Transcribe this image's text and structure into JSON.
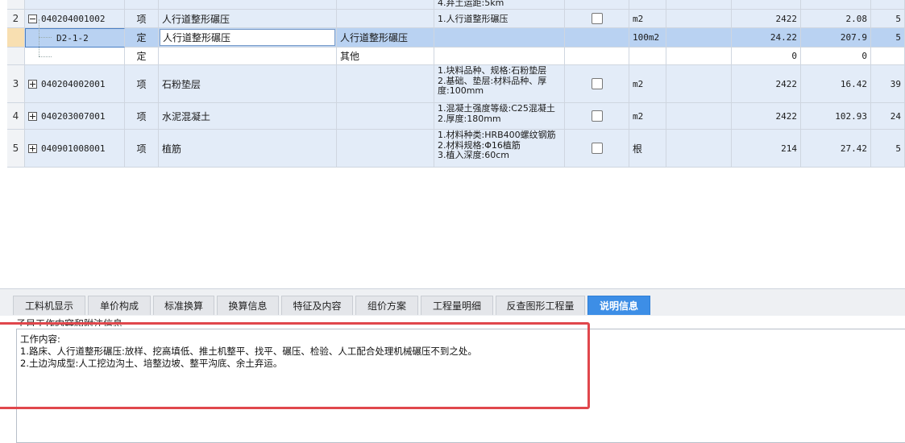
{
  "top_partial_feature": "4.弃土运距:5km",
  "rows": [
    {
      "num": "2",
      "code": "040204001002",
      "type": "项",
      "name": "人行道整形碾压",
      "feature": "1.人行道整形碾压",
      "unit": "m2",
      "qty": "2422",
      "price": "2.08",
      "total": "5"
    },
    {
      "code": "D2-1-2",
      "type": "定",
      "name": "人行道整形碾压",
      "content": "人行道整形碾压",
      "unit": "100m2",
      "qty": "24.22",
      "price": "207.9",
      "total": "5"
    },
    {
      "type": "定",
      "content": "其他",
      "qty": "0",
      "price": "0"
    },
    {
      "num": "3",
      "code": "040204002001",
      "type": "项",
      "name": "石粉垫层",
      "feature": [
        "1.块料品种、规格:石粉垫层",
        "2.基础、垫层:材料品种、厚",
        "度:100mm"
      ],
      "unit": "m2",
      "qty": "2422",
      "price": "16.42",
      "total": "39"
    },
    {
      "num": "4",
      "code": "040203007001",
      "type": "项",
      "name": "水泥混凝土",
      "feature": [
        "1.混凝土强度等级:C25混凝土",
        "2.厚度:180mm"
      ],
      "unit": "m2",
      "qty": "2422",
      "price": "102.93",
      "total": "24"
    },
    {
      "num": "5",
      "code": "040901008001",
      "type": "项",
      "name": "植筋",
      "feature": [
        "1.材料种类:HRB400螺纹钢筋",
        "2.材料规格:Φ16植筋",
        "3.植入深度:60cm"
      ],
      "unit": "根",
      "qty": "214",
      "price": "27.42",
      "total": "5"
    }
  ],
  "tabs": [
    "工料机显示",
    "单价构成",
    "标准换算",
    "换算信息",
    "特征及内容",
    "组价方案",
    "工程量明细",
    "反查图形工程量",
    "说明信息"
  ],
  "active_tab": "说明信息",
  "desc": {
    "title": "子目工作内容和附注信息",
    "lines": [
      "工作内容:",
      "1.路床、人行道整形碾压:放样、挖高填低、推土机整平、找平、碾压、检验、人工配合处理机械碾压不到之处。",
      "2.土边沟成型:人工挖边沟土、培整边坡、整平沟底、余土弃运。"
    ]
  },
  "colors": {
    "row_blue": "#e3ecf8",
    "selected_row": "#b9d2f2",
    "active_tab": "#3d8ee6",
    "highlight_border": "#e0474c"
  }
}
